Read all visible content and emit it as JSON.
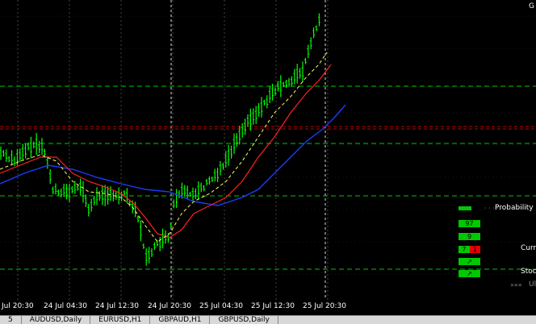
{
  "corner_label": "G",
  "time_axis": [
    "Jul 20:30",
    "24 Jul 04:30",
    "24 Jul 12:30",
    "24 Jul 20:30",
    "25 Jul 04:30",
    "25 Jul 12:30",
    "25 Jul 20:30"
  ],
  "tabs": [
    "5",
    "AUDUSD,Daily",
    "EURUSD,H1",
    "GBPAUD,H1",
    "GBPUSD,Daily"
  ],
  "panel": {
    "title": "Probability",
    "box_top": "97",
    "box_2": "9",
    "box_3_left": "7",
    "box_3_right": "1",
    "label_curr": "Curr",
    "label_stoc": "Stoc",
    "label_ult": "Ul",
    "arrow": "↗"
  },
  "colors": {
    "background": "#000000",
    "bull_bar": "#00ff00",
    "ma_red": "#ff2020",
    "ma_blue": "#1a3cff",
    "ma_yellow": "#ffff66",
    "grid_green": "#00c800",
    "resistance_red": "#c00000"
  }
}
